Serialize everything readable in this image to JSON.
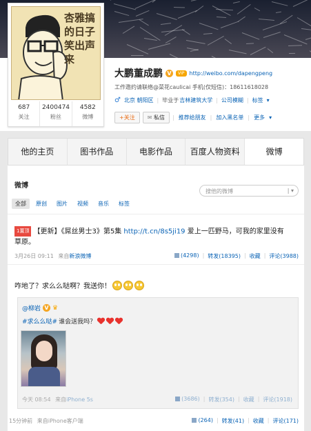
{
  "profile": {
    "avatar_text": "杏雅搞的日子笑出声来",
    "name": "大鹏董成鹏",
    "v_badge": "V",
    "vip_badge": "VIP",
    "homepage_url": "http://weibo.com/dapengpeng",
    "description": "工作邀约请联络@菜花caulicai 手机(仅短信)：18611618028",
    "gender_icon": "male-icon",
    "location": "北京 朝阳区",
    "school_prefix": "毕业于",
    "school": "吉林建筑大学",
    "company": "公司模糊",
    "tags": "标签",
    "stats": [
      {
        "num": "687",
        "label": "关注"
      },
      {
        "num": "2400474",
        "label": "粉丝"
      },
      {
        "num": "4582",
        "label": "微博"
      }
    ]
  },
  "buttons": {
    "follow": "+关注",
    "message": "私信",
    "recommend": "推荐给朋友",
    "add_group": "加入黑名单",
    "more": "更多"
  },
  "tabs": [
    "他的主页",
    "图书作品",
    "电影作品",
    "百度人物资料",
    "微博"
  ],
  "feed": {
    "title": "微博",
    "search_placeholder": "搜他的微博",
    "filters": [
      "全部",
      "原创",
      "图片",
      "视频",
      "音乐",
      "标签"
    ]
  },
  "post1": {
    "badge": "1置顶",
    "text_prefix": "【更新】《屌丝男士3》第5集",
    "link": "http://t.cn/8s5ji19",
    "text_suffix": "爱上一匹野马，可我的家里没有",
    "text_line2": "草原。",
    "time": "3月26日 09:11",
    "source_prefix": "来自",
    "source": "新浪微博",
    "likes": "(4298)",
    "forward": "转发(18395)",
    "collect": "收藏",
    "comment": "评论(3988)"
  },
  "post2": {
    "text": "咋地了？求么么哒啊？我送你！",
    "repost_author": "@柳岩",
    "repost_v": "V",
    "repost_text_tag": "#求么么哒#",
    "repost_text": "谁会送我吗？",
    "repost_time": "今天 08:54",
    "repost_source_prefix": "来自",
    "repost_source": "iPhone 5s",
    "repost_likes": "(3686)",
    "repost_forward": "转发(354)",
    "repost_collect": "收藏",
    "repost_comment": "评论(1918)",
    "time": "15分钟前",
    "source_prefix": "来自",
    "source": "iPhone客户端",
    "likes": "(264)",
    "forward": "转发(41)",
    "collect": "收藏",
    "comment": "评论(171)"
  }
}
